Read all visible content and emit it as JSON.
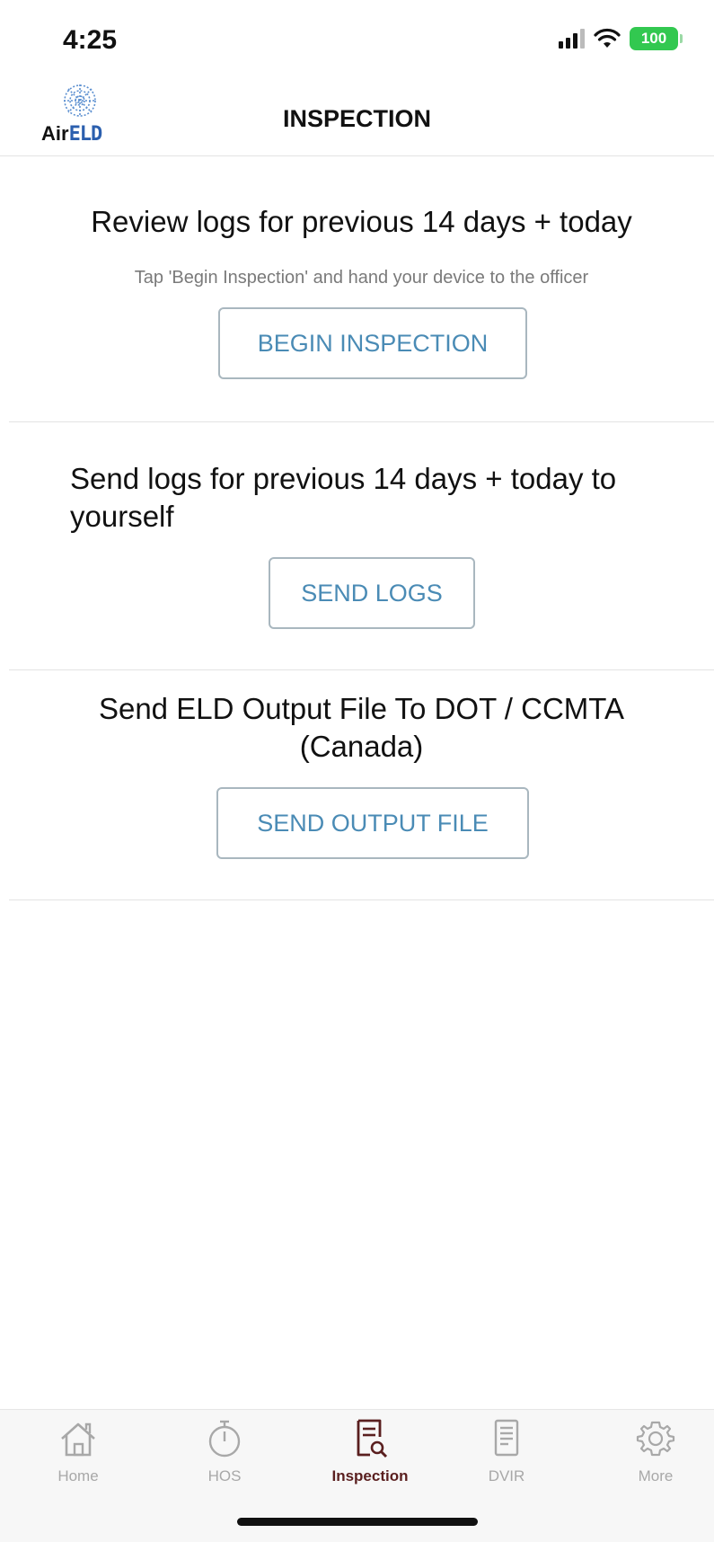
{
  "status_bar": {
    "time": "4:25",
    "battery": "100",
    "battery_color": "#32c850"
  },
  "header": {
    "logo_air": "Air",
    "logo_eld": "ELD",
    "title": "INSPECTION"
  },
  "sections": {
    "review": {
      "heading": "Review logs for previous 14 days +  today",
      "subtext": "Tap 'Begin Inspection' and hand your device to the officer",
      "button_label": "BEGIN INSPECTION"
    },
    "send_logs": {
      "heading": "Send logs for previous 14 days + today to yourself",
      "button_label": "SEND LOGS"
    },
    "output_file": {
      "heading": "Send ELD Output File To DOT / CCMTA (Canada)",
      "button_label": "SEND OUTPUT FILE"
    }
  },
  "tab_bar": {
    "items": [
      {
        "label": "Home",
        "icon": "home-icon",
        "active": false
      },
      {
        "label": "HOS",
        "icon": "stopwatch-icon",
        "active": false
      },
      {
        "label": "Inspection",
        "icon": "inspection-icon",
        "active": true
      },
      {
        "label": "DVIR",
        "icon": "document-icon",
        "active": false
      },
      {
        "label": "More",
        "icon": "gear-icon",
        "active": false
      }
    ]
  },
  "colors": {
    "accent_button_text": "#4a8bb5",
    "active_tab": "#5a1f1f",
    "logo_blue": "#2b5fae"
  }
}
